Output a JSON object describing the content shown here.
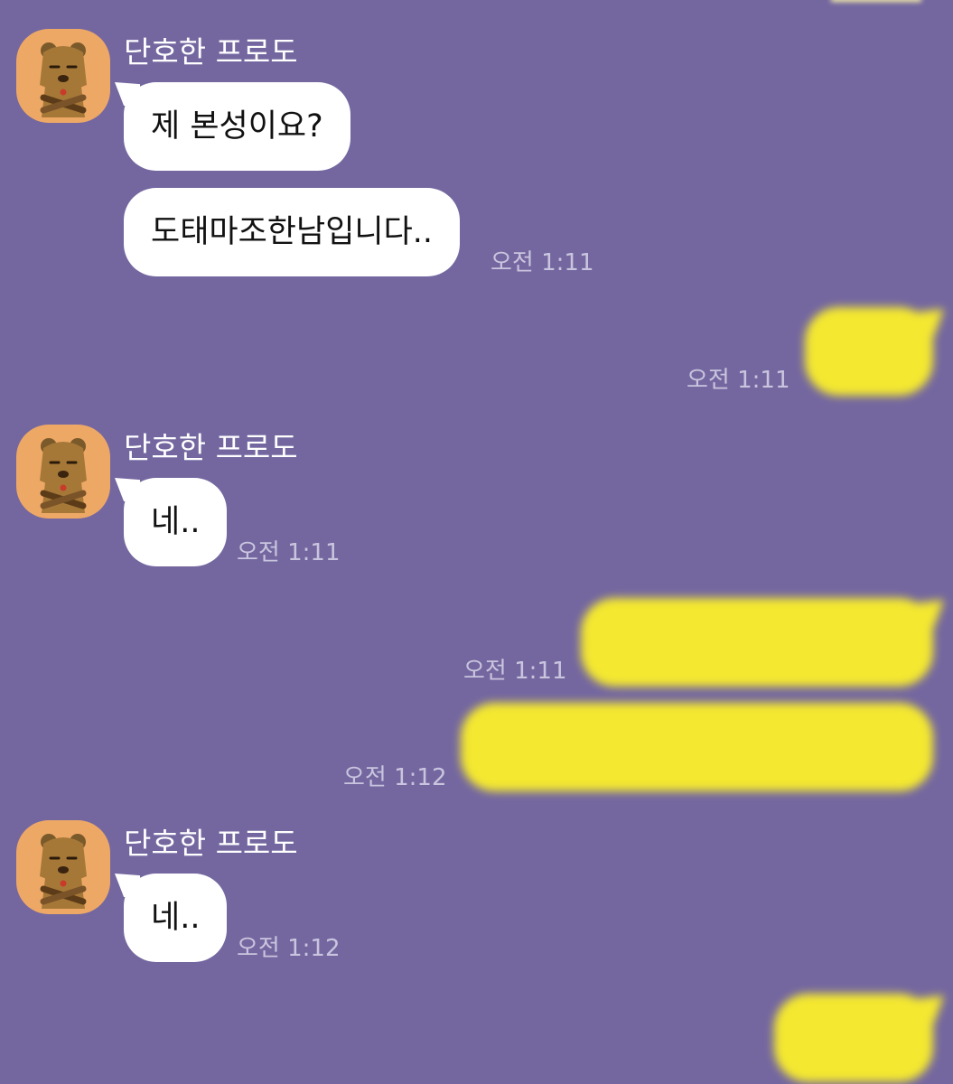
{
  "chat": {
    "background_color": "#7467a0",
    "my_bubble_color": "#f4e830",
    "their_bubble_color": "#ffffff",
    "messages": [
      {
        "sender": "단호한 프로도",
        "avatar_icon": "ryan-bear-icon",
        "lines": [
          "제 본성이요?",
          "도태마조한남입니다.."
        ],
        "time": "오전 1:11"
      },
      {
        "sender": "me",
        "text": "",
        "time": "오전 1:11",
        "content_redacted": true
      },
      {
        "sender": "단호한 프로도",
        "avatar_icon": "ryan-bear-icon",
        "lines": [
          "네.."
        ],
        "time": "오전 1:11"
      },
      {
        "sender": "me",
        "text": "",
        "time": "오전 1:11",
        "content_redacted": true
      },
      {
        "sender": "me",
        "text": "",
        "time": "오전 1:12",
        "content_redacted": true
      },
      {
        "sender": "단호한 프로도",
        "avatar_icon": "ryan-bear-icon",
        "lines": [
          "네.."
        ],
        "time": "오전 1:12"
      },
      {
        "sender": "me",
        "text": "",
        "time": "",
        "content_redacted": true
      }
    ]
  }
}
